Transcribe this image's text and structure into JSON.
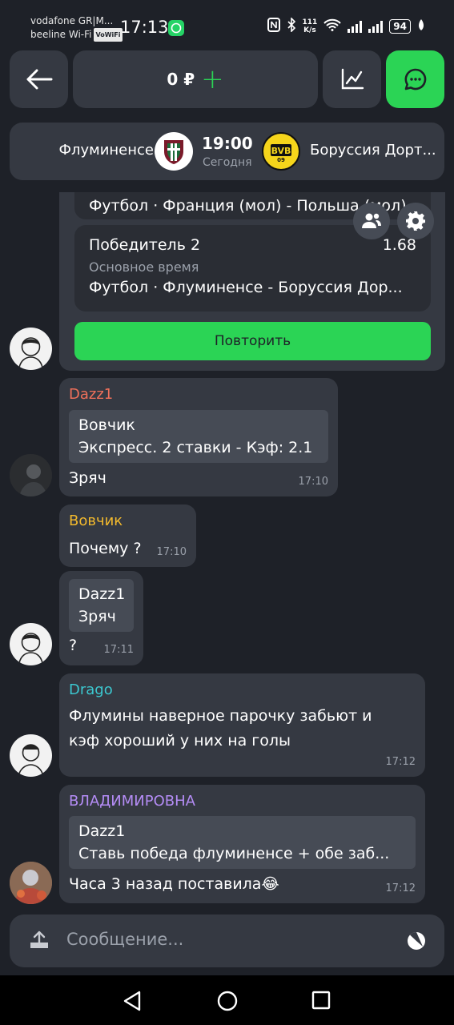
{
  "status_bar": {
    "carrier1": "vodafone GR|M...",
    "carrier2": "beeline Wi-Fi",
    "vowifi": "VoWiFi",
    "time": "17:13",
    "speed_value": "111",
    "speed_unit": "K/s",
    "battery": "94"
  },
  "toolbar": {
    "balance": "0 ₽",
    "plus": "+"
  },
  "match": {
    "home_team": "Флуминенсе",
    "away_team": "Боруссия Дорт...",
    "time": "19:00",
    "day": "Сегодня"
  },
  "bet": {
    "prev_event": "Футбол · Франция (мол) - Польша (мол)",
    "title": "Победитель 2",
    "odds": "1.68",
    "subtitle": "Основное время",
    "event": "Футбол · Флуминенсе - Боруссия Дор...",
    "repeat_label": "Повторить"
  },
  "messages": [
    {
      "sender": "Dazz1",
      "sender_color": "#f0705a",
      "quote_author": "Вовчик",
      "quote_text": "Экспресс. 2 ставки - Кэф: 2.1",
      "text": "Зряч",
      "time": "17:10"
    },
    {
      "sender": "Вовчик",
      "sender_color": "#f2b92d",
      "text": "Почему ?",
      "time": "17:10"
    },
    {
      "quote_author": "Dazz1",
      "quote_text": "Зряч",
      "text": "?",
      "time": "17:11"
    },
    {
      "sender": "Drago",
      "sender_color": "#3cc8d0",
      "text_line1": "Флумины наверное парочку забьют и",
      "text_line2": "кэф хороший у них на голы",
      "time": "17:12"
    },
    {
      "sender": "ВЛАДИМИРОВНА",
      "sender_color": "#b48cf5",
      "quote_author": "Dazz1",
      "quote_text": "Ставь победа флуминенсе + обе заб...",
      "text": "Часа 3 назад поставила😂",
      "time": "17:12"
    }
  ],
  "input": {
    "placeholder": "Сообщение..."
  },
  "colors": {
    "background": "#1e2128",
    "surface": "#353942",
    "accent_green": "#2bd455"
  }
}
